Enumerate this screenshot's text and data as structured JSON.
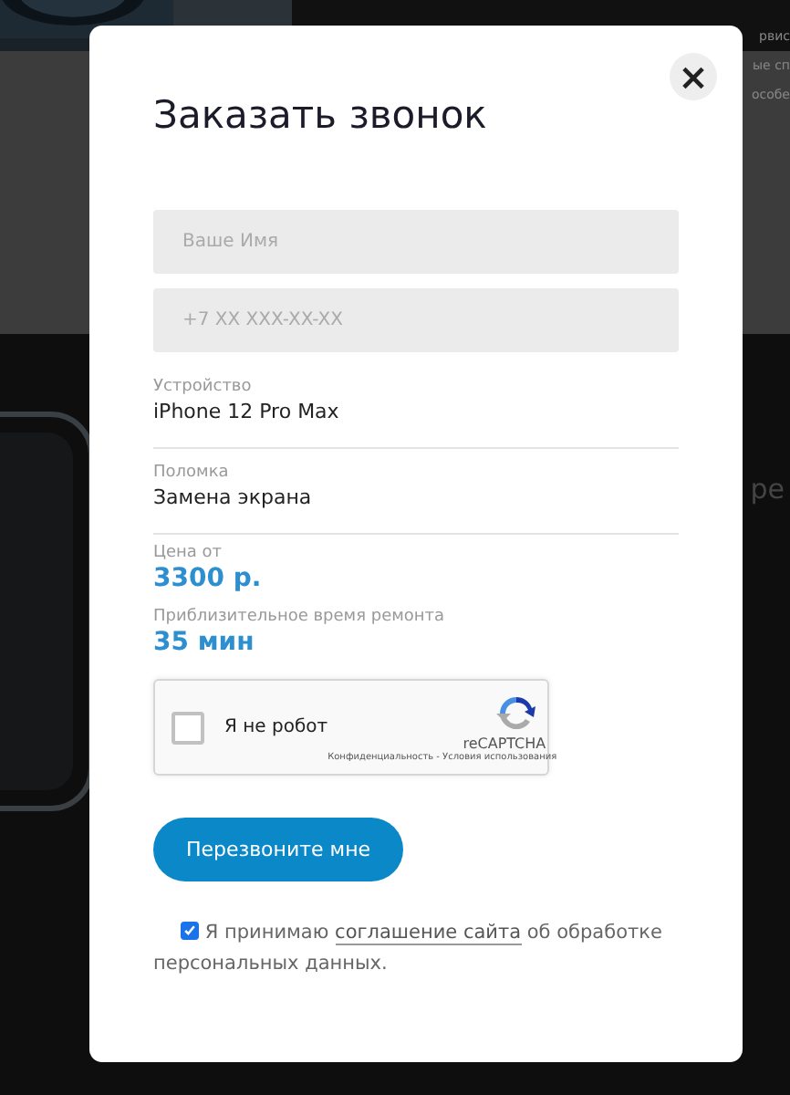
{
  "background": {
    "texts": [
      "рвис",
      "ые сп",
      "особе",
      "ре"
    ]
  },
  "dialog": {
    "title": "Заказать звонок",
    "close": "×",
    "fields": [
      {
        "placeholder": "Ваше Имя"
      },
      {
        "placeholder": "+7 XX XXX-XX-XX"
      }
    ],
    "details": [
      {
        "kind": "plain",
        "label": "Устройство",
        "value": "iPhone 12 Pro Max"
      },
      {
        "kind": "plain",
        "label": "Поломка",
        "value": "Замена экрана"
      },
      {
        "kind": "accent",
        "label": "Цена от",
        "value": "3300 р."
      },
      {
        "kind": "accent",
        "label": "Приблизительное время ремонта",
        "value": "35 мин"
      }
    ],
    "captcha": {
      "label": "Я не робот",
      "checked": false,
      "brand": "reCAPTCHA",
      "links": "Конфиденциальность - Условия использования"
    },
    "submit": "Перезвоните мне",
    "consent": {
      "checked": true,
      "before": "Я принимаю",
      "link": "соглашение сайта",
      "after": "об обработке персональных данных."
    }
  }
}
